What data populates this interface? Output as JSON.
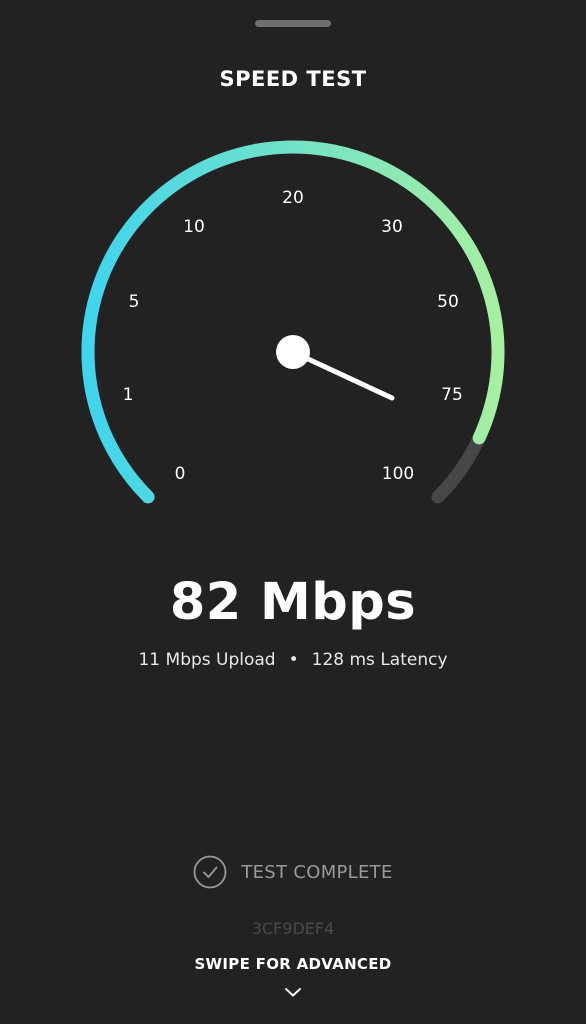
{
  "header": {
    "title": "SPEED TEST"
  },
  "gauge": {
    "tick_labels": [
      "0",
      "1",
      "5",
      "10",
      "20",
      "30",
      "50",
      "75",
      "100"
    ],
    "reading_mbps": 82,
    "arc_fill_fraction": 0.925,
    "colors": {
      "gradient_start": "#40d4ee",
      "gradient_end": "#a6f0a0",
      "track": "#474747",
      "needle": "#ffffff"
    }
  },
  "result": {
    "download": "82 Mbps",
    "upload": "11 Mbps Upload",
    "separator": "•",
    "latency": "128 ms Latency"
  },
  "status": {
    "icon": "checkmark-circle-icon",
    "text": "TEST COMPLETE"
  },
  "test_id": "3CF9DEF4",
  "footer": {
    "swipe_label": "SWIPE FOR ADVANCED",
    "icon": "chevron-down-icon"
  }
}
